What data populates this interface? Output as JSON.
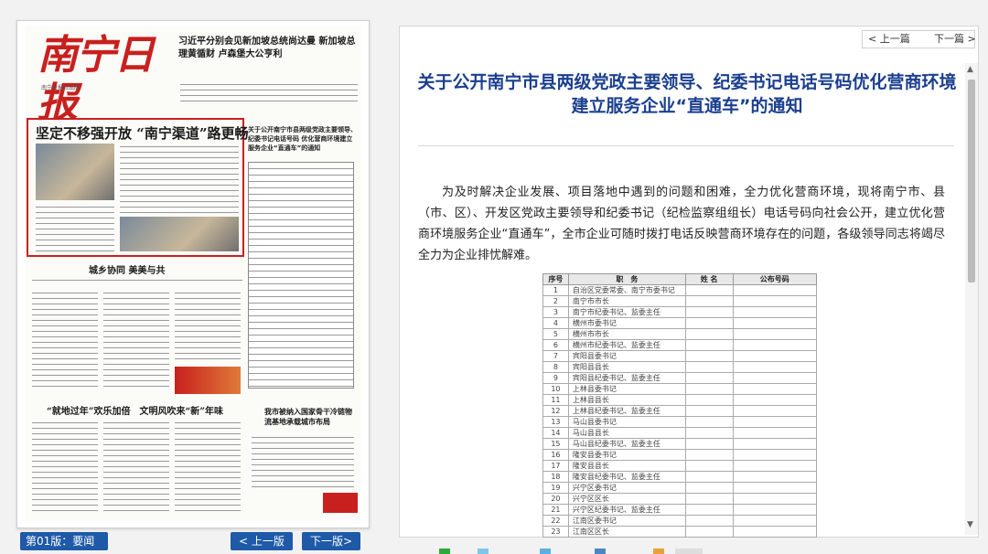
{
  "newspaper": {
    "masthead": "南宁日报",
    "masthead_sub": "南宁日报社出版",
    "top_headline": "习近平分别会见新加坡总统尚达曼 新加坡总理黄循财 卢森堡大公亨利",
    "lead_box_title": "坚定不移强开放 “南宁渠道”路更畅",
    "mini_table_head": "关于公开南宁市县两级党政主要领导、纪委书记电话号码 优化营商环境建立服务企业“直通车”的通知",
    "story2_title": "城乡协同 美美与共",
    "story3_title": "“就地过年”欢乐加倍　文明风吹来“新”年味",
    "story4_title": "我市被纳入国家骨干冷链物流基地承载城市布局"
  },
  "controls": {
    "edition_label": "第01版：要闻",
    "prev_edition": "< 上一版",
    "next_edition": "下一版>"
  },
  "article": {
    "nav_prev": "< 上一篇",
    "nav_next": "下一篇 >",
    "title": "关于公开南宁市县两级党政主要领导、纪委书记电话号码优化营商环境建立服务企业“直通车”的通知",
    "body": "为及时解决企业发展、项目落地中遇到的问题和困难，全力优化营商环境，现将南宁市、县（市、区）、开发区党政主要领导和纪委书记（纪检监察组组长）电话号码向社会公开，建立优化营商环境服务企业“直通车”，全市企业可随时拨打电话反映营商环境存在的问题，各级领导同志将竭尽全力为企业排忧解难。",
    "table_headers": [
      "序号",
      "职　务",
      "姓 名",
      "公布号码"
    ],
    "table_rows": [
      [
        "1",
        "自治区党委常委、南宁市委书记",
        "",
        ""
      ],
      [
        "2",
        "南宁市市长",
        "",
        ""
      ],
      [
        "3",
        "南宁市纪委书记、监委主任",
        "",
        ""
      ],
      [
        "4",
        "横州市委书记",
        "",
        ""
      ],
      [
        "5",
        "横州市市长",
        "",
        ""
      ],
      [
        "6",
        "横州市纪委书记、监委主任",
        "",
        ""
      ],
      [
        "7",
        "宾阳县委书记",
        "",
        ""
      ],
      [
        "8",
        "宾阳县县长",
        "",
        ""
      ],
      [
        "9",
        "宾阳县纪委书记、监委主任",
        "",
        ""
      ],
      [
        "10",
        "上林县委书记",
        "",
        ""
      ],
      [
        "11",
        "上林县县长",
        "",
        ""
      ],
      [
        "12",
        "上林县纪委书记、监委主任",
        "",
        ""
      ],
      [
        "13",
        "马山县委书记",
        "",
        ""
      ],
      [
        "14",
        "马山县县长",
        "",
        ""
      ],
      [
        "15",
        "马山县纪委书记、监委主任",
        "",
        ""
      ],
      [
        "16",
        "隆安县委书记",
        "",
        ""
      ],
      [
        "17",
        "隆安县县长",
        "",
        ""
      ],
      [
        "18",
        "隆安县纪委书记、监委主任",
        "",
        ""
      ],
      [
        "19",
        "兴宁区委书记",
        "",
        ""
      ],
      [
        "20",
        "兴宁区区长",
        "",
        ""
      ],
      [
        "21",
        "兴宁区纪委书记、监委主任",
        "",
        ""
      ],
      [
        "22",
        "江南区委书记",
        "",
        ""
      ],
      [
        "23",
        "江南区区长",
        "",
        ""
      ]
    ]
  }
}
